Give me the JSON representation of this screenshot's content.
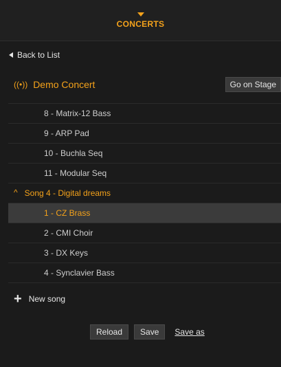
{
  "header": {
    "title": "CONCERTS"
  },
  "nav": {
    "back_label": "Back to List"
  },
  "concert": {
    "icon": "((•))",
    "name": "Demo Concert",
    "stage_button": "Go on Stage"
  },
  "list": {
    "song3_items": [
      "8 - Matrix-12 Bass",
      "9 - ARP Pad",
      "10 - Buchla Seq",
      "11 - Modular Seq"
    ],
    "song4": {
      "chevron": "^",
      "label": "Song 4 - Digital dreams"
    },
    "song4_items": [
      "1 - CZ Brass",
      "2 - CMI Choir",
      "3 - DX Keys",
      "4 - Synclavier Bass"
    ],
    "selected_index": 0
  },
  "new_song": {
    "icon": "+",
    "label": "New song"
  },
  "actions": {
    "reload": "Reload",
    "save": "Save",
    "save_as": "Save as"
  },
  "colors": {
    "accent": "#f4a21b",
    "background": "#1b1b1b",
    "selected_row": "#3b3b3b"
  }
}
